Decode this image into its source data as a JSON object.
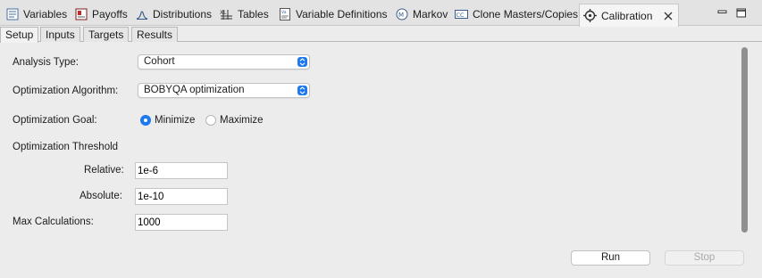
{
  "view_tabs": [
    {
      "label": "Variables",
      "icon": "variables-icon"
    },
    {
      "label": "Payoffs",
      "icon": "payoffs-icon"
    },
    {
      "label": "Distributions",
      "icon": "distributions-icon"
    },
    {
      "label": "Tables",
      "icon": "tables-icon"
    },
    {
      "label": "Variable Definitions",
      "icon": "variable-definitions-icon"
    },
    {
      "label": "Markov",
      "icon": "markov-icon"
    },
    {
      "label": "Clone Masters/Copies",
      "icon": "clone-masters-icon"
    },
    {
      "label": "Calibration",
      "icon": "calibration-icon",
      "active": true
    }
  ],
  "sub_tabs": [
    {
      "label": "Setup",
      "active": true
    },
    {
      "label": "Inputs"
    },
    {
      "label": "Targets"
    },
    {
      "label": "Results"
    }
  ],
  "setup": {
    "analysis_type_label": "Analysis Type:",
    "analysis_type_value": "Cohort",
    "algorithm_label": "Optimization Algorithm:",
    "algorithm_value": "BOBYQA optimization",
    "goal_label": "Optimization Goal:",
    "goal_minimize": "Minimize",
    "goal_maximize": "Maximize",
    "goal_selected": "Minimize",
    "threshold_heading": "Optimization Threshold",
    "relative_label": "Relative:",
    "relative_value": "1e-6",
    "absolute_label": "Absolute:",
    "absolute_value": "1e-10",
    "max_calc_label": "Max Calculations:",
    "max_calc_value": "1000"
  },
  "buttons": {
    "run": "Run",
    "stop": "Stop"
  },
  "colors": {
    "accent": "#1e78f0",
    "disabled_text": "#a8a8a8"
  }
}
